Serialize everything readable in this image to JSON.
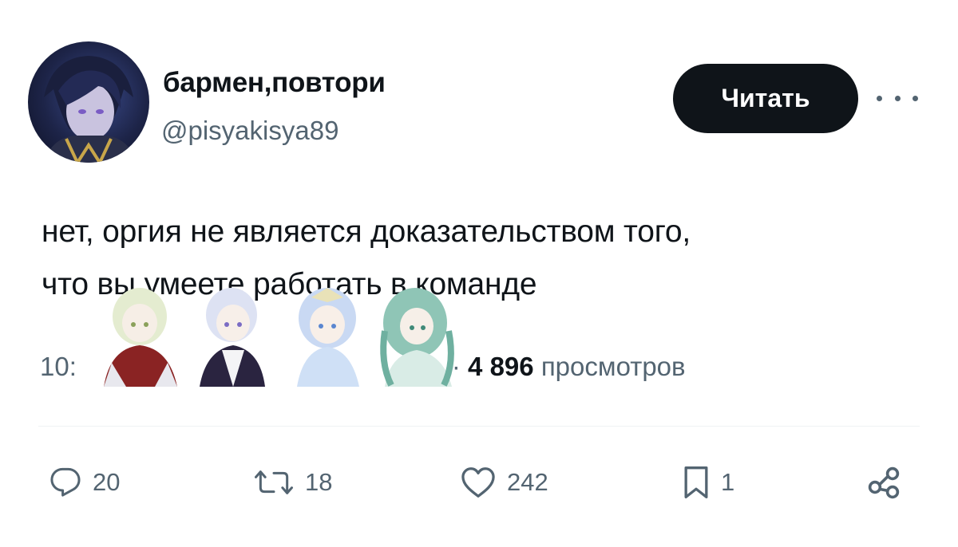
{
  "user": {
    "display_name": "бармен,повтори",
    "handle": "@pisyakisya89"
  },
  "follow_button_label": "Читать",
  "tweet": {
    "lines": [
      "нет, оргия не является доказательством того,",
      "что вы умеете работать в команде"
    ]
  },
  "meta": {
    "time_prefix": "10:",
    "separator": "·",
    "views_count": "4 896",
    "views_label": "просмотров"
  },
  "actions": {
    "replies": "20",
    "reposts": "18",
    "likes": "242",
    "bookmarks": "1"
  },
  "icons": [
    "more-options-icon",
    "reply-icon",
    "repost-icon",
    "like-icon",
    "bookmark-icon",
    "share-icon"
  ],
  "colors": {
    "primary_text": "#0f1419",
    "secondary_text": "#536471",
    "button_bg": "#0f1419",
    "button_text": "#ffffff",
    "divider": "#eff3f4"
  }
}
